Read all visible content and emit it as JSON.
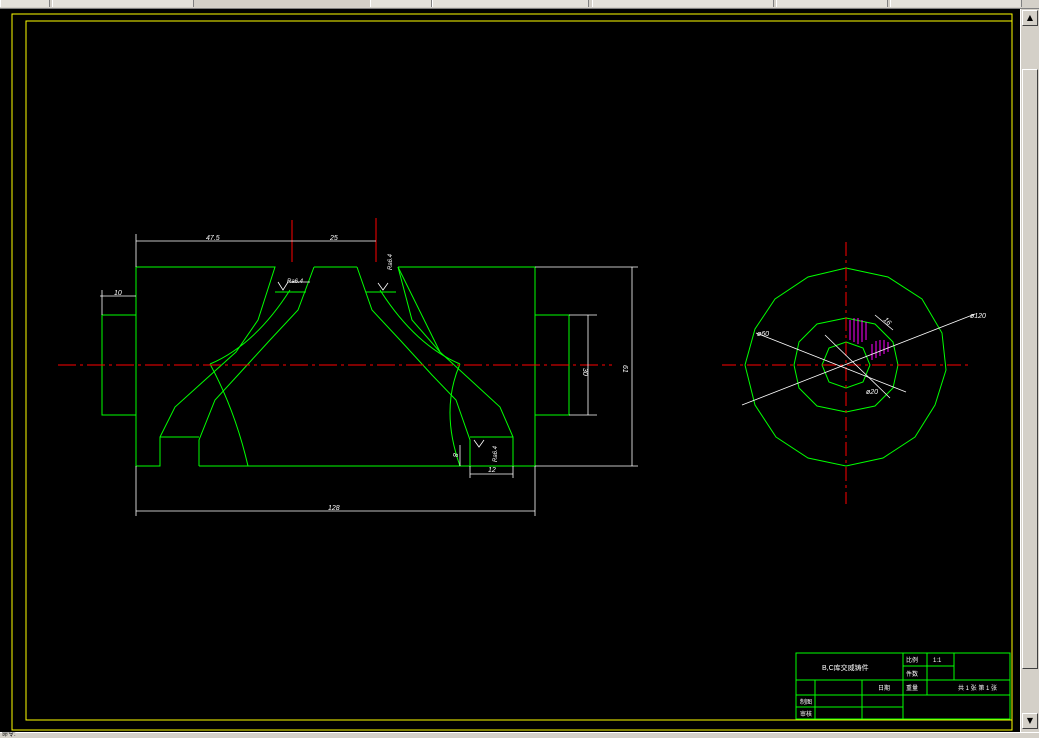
{
  "window": {
    "status_text": "命令:"
  },
  "drawing": {
    "dimensions": {
      "d_47_5": "47.5",
      "d_25": "25",
      "d_10": "10",
      "d_30": "30",
      "d_61": "61",
      "d_8": "8",
      "d_12": "12",
      "d_128": "128",
      "ra_1": "Ra6.4",
      "ra_2": "Ra6.4",
      "ra_3": "Ra6.4",
      "phi_60": "ø60",
      "phi_120": "ø120",
      "phi_20": "ø20",
      "d_16": "16"
    },
    "title_block": {
      "part_name": "B,C库交威铸件",
      "ratio_label": "比例",
      "ratio_value": "1:1",
      "material_label": "件数",
      "date_label": "日期",
      "weight_label": "重量",
      "sheet_text": "共 1 张 第 1 张",
      "drawn_label": "制图",
      "checked_label": "审核"
    }
  },
  "colors": {
    "background": "#000000",
    "frame": "#ffff00",
    "geometry": "#00ff00",
    "centerline": "#ff0000",
    "dimension": "#ffffff",
    "hatch": "#ff00ff"
  }
}
